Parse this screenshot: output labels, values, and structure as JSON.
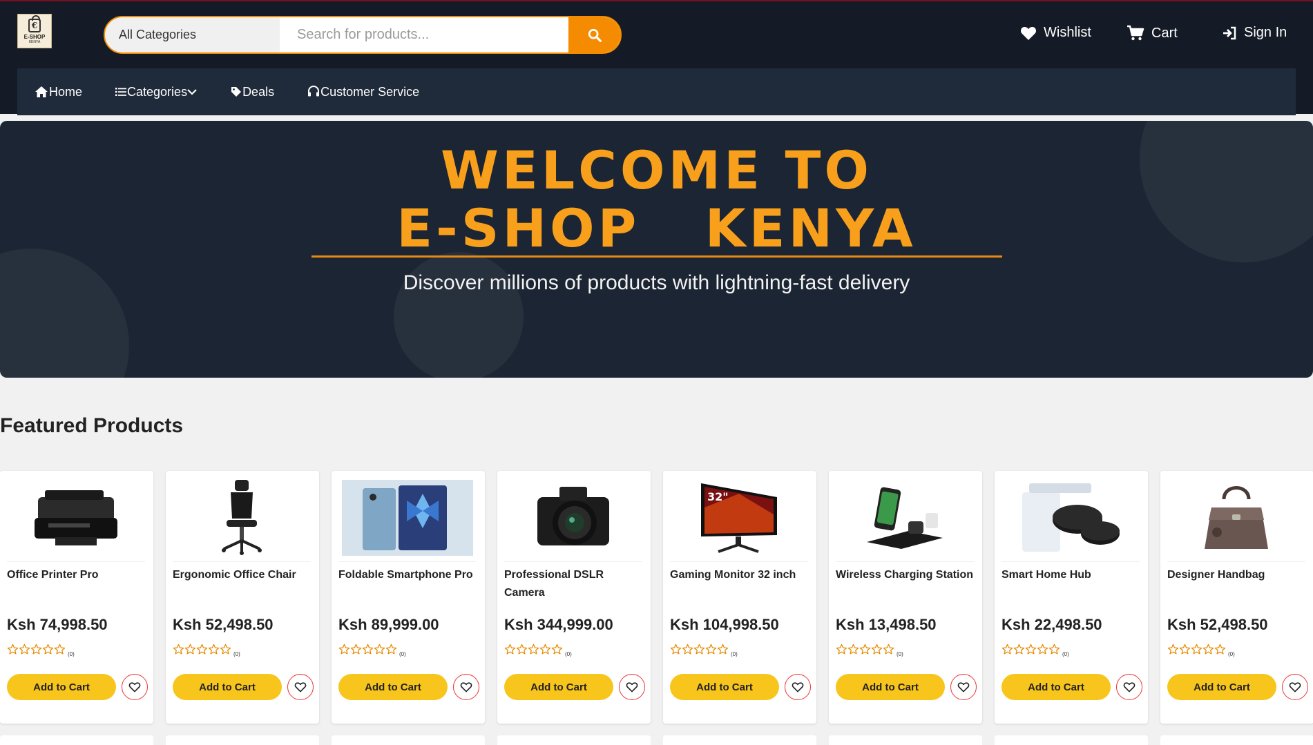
{
  "header": {
    "logo_text": "E-SHOP",
    "logo_sub": "KENYA",
    "search": {
      "category_label": "All Categories",
      "placeholder": "Search for products..."
    },
    "links": {
      "wishlist": "Wishlist",
      "cart": "Cart",
      "signin": "Sign In"
    }
  },
  "nav": {
    "home": "Home",
    "categories": "Categories",
    "deals": "Deals",
    "customer_service": "Customer Service"
  },
  "hero": {
    "title_line1": "WELCOME TO",
    "title_line2": "E-SHOP   KENYA",
    "subtitle": "Discover millions of products with lightning-fast delivery"
  },
  "featured": {
    "title": "Featured Products",
    "add_label": "Add to Cart",
    "products": [
      {
        "name": "Office Printer Pro",
        "price": "Ksh 74,998.50",
        "rating_count": "(0)",
        "icon": "printer"
      },
      {
        "name": "Ergonomic Office Chair",
        "price": "Ksh 52,498.50",
        "rating_count": "(0)",
        "icon": "chair"
      },
      {
        "name": "Foldable Smartphone Pro",
        "price": "Ksh 89,999.00",
        "rating_count": "(0)",
        "icon": "phone"
      },
      {
        "name": "Professional DSLR Camera",
        "price": "Ksh 344,999.00",
        "rating_count": "(0)",
        "icon": "camera"
      },
      {
        "name": "Gaming Monitor 32 inch",
        "price": "Ksh 104,998.50",
        "rating_count": "(0)",
        "icon": "monitor"
      },
      {
        "name": "Wireless Charging Station",
        "price": "Ksh 13,498.50",
        "rating_count": "(0)",
        "icon": "charger"
      },
      {
        "name": "Smart Home Hub",
        "price": "Ksh 22,498.50",
        "rating_count": "(0)",
        "icon": "hub"
      },
      {
        "name": "Designer Handbag",
        "price": "Ksh 52,498.50",
        "rating_count": "(0)",
        "icon": "handbag"
      }
    ]
  },
  "colors": {
    "header_bg": "#141b26",
    "accent": "#f58b00",
    "button": "#f8c51c"
  }
}
